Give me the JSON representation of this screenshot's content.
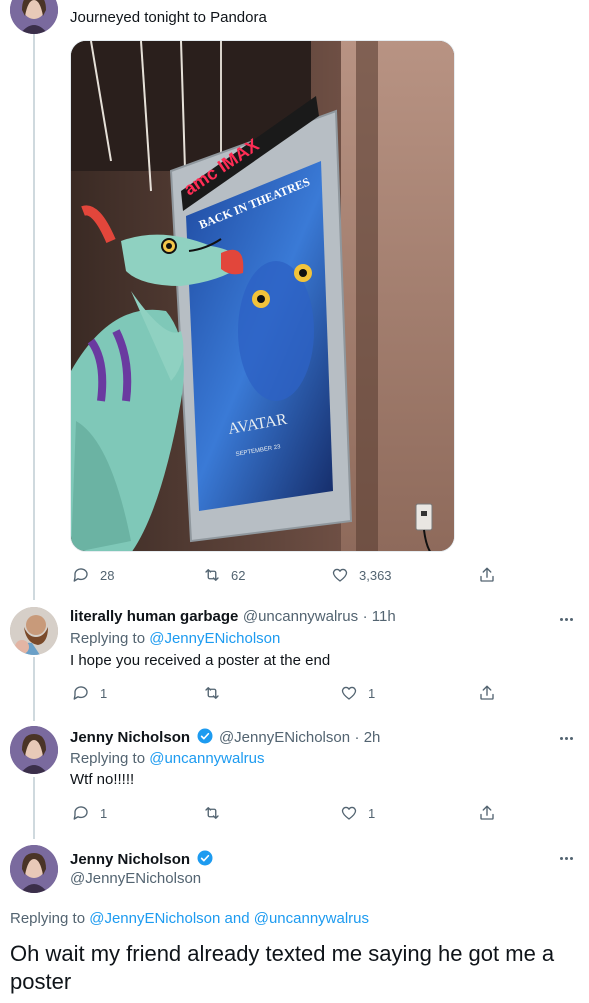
{
  "top_tweet": {
    "text": "Journeyed tonight to Pandora",
    "photo": {
      "sign_brand": "amc IMAX",
      "poster_banner": "BACK IN THEATRES",
      "poster_title": "AVATAR",
      "poster_date": "SEPTEMBER 23"
    },
    "actions": {
      "replies": "28",
      "retweets": "62",
      "likes": "3,363"
    }
  },
  "replies": [
    {
      "name": "literally human garbage",
      "handle": "@uncannywalrus",
      "time": "· 11h",
      "replying_to_label": "Replying to",
      "replying_to": "@JennyENicholson",
      "text": "I hope you received a poster at the end",
      "actions": {
        "replies": "1",
        "retweets": "",
        "likes": "1"
      }
    },
    {
      "name": "Jenny Nicholson",
      "handle": "@JennyENicholson",
      "time": "· 2h",
      "replying_to_label": "Replying to",
      "replying_to": "@uncannywalrus",
      "text": "Wtf no!!!!!",
      "actions": {
        "replies": "1",
        "retweets": "",
        "likes": "1"
      }
    }
  ],
  "main_tweet": {
    "name": "Jenny Nicholson",
    "handle": "@JennyENicholson",
    "replying_to_label": "Replying to",
    "replying_to_1": "@JennyENicholson",
    "and": "and",
    "replying_to_2": "@uncannywalrus",
    "text": "Oh wait my friend already texted me saying he got me a poster"
  },
  "colors": {
    "link": "#1d9bf0",
    "verified": "#1d9bf0",
    "secondary": "#536471",
    "thread_line": "#cfd9de"
  }
}
